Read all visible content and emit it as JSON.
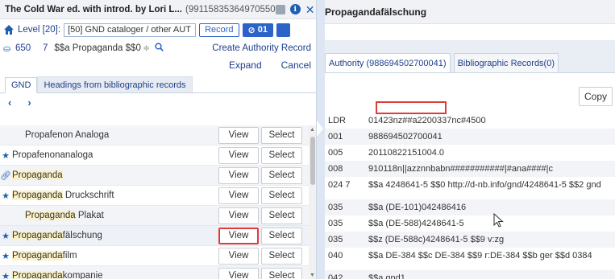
{
  "left": {
    "title": "The Cold War ed. with introd. by Lori L...",
    "title_id": "(99115835364970550",
    "level_label": "Level [20]:",
    "level_select": "[50] GND cataloger / other AUT",
    "record_button": "Record",
    "count_button": "01",
    "field": {
      "tag": "650",
      "indicator": "7",
      "subfield": "$$a Propaganda $$0",
      "create_link": "Create Authority Record"
    },
    "expand_link": "Expand",
    "cancel_link": "Cancel",
    "tabs": [
      "GND",
      "Headings from bibliographic records"
    ],
    "nav_prev": "‹",
    "nav_next": "›",
    "list": [
      {
        "prefix": "Propafenon Analoga",
        "highlight": "",
        "suffix": "",
        "icon": "none",
        "view": "View",
        "select": "Select"
      },
      {
        "prefix": "Propafenonanaloga",
        "highlight": "",
        "suffix": "",
        "icon": "star",
        "view": "View",
        "select": "Select"
      },
      {
        "prefix": "",
        "highlight": "Propaganda",
        "suffix": "",
        "icon": "link",
        "view": "View",
        "select": "Select"
      },
      {
        "prefix": "",
        "highlight": "Propaganda",
        "suffix": " Druckschrift",
        "icon": "star",
        "view": "View",
        "select": "Select"
      },
      {
        "prefix": "",
        "highlight": "Propaganda",
        "suffix": " Plakat",
        "icon": "none",
        "view": "View",
        "select": "Select"
      },
      {
        "prefix": "",
        "highlight": "Propaganda",
        "suffix": "fälschung",
        "icon": "star",
        "view": "View",
        "select": "Select"
      },
      {
        "prefix": "",
        "highlight": "Propaganda",
        "suffix": "film",
        "icon": "star",
        "view": "View",
        "select": "Select"
      },
      {
        "prefix": "",
        "highlight": "Propaganda",
        "suffix": "kompanie",
        "icon": "star",
        "view": "View",
        "select": "Select"
      }
    ]
  },
  "right": {
    "title": "Propagandafälschung",
    "tabs": [
      "Authority (988694502700041)",
      "Bibliographic Records(0)"
    ],
    "copy_button": "Copy",
    "marc": [
      {
        "tag": "LDR",
        "value": "01423nz##a2200337nc#4500"
      },
      {
        "tag": "001",
        "value": "988694502700041"
      },
      {
        "tag": "005",
        "value": "20110822151004.0"
      },
      {
        "tag": "008",
        "value": "910118n||azznnbabn###########|#ana####|c"
      },
      {
        "tag": "024 7",
        "value": "$$a 4248641-5 $$0 http://d-nb.info/gnd/4248641-5 $$2 gnd"
      },
      {
        "tag": "035",
        "value": "$$a (DE-101)042486416"
      },
      {
        "tag": "035",
        "value": "$$a (DE-588)4248641-5"
      },
      {
        "tag": "035",
        "value": "$$z (DE-588c)4248641-5 $$9 v:zg"
      },
      {
        "tag": "040",
        "value": "$$a DE-384 $$c DE-384 $$9 r:DE-384 $$b ger $$d 0384"
      },
      {
        "tag": "042",
        "value": "$$a gnd1"
      }
    ]
  }
}
